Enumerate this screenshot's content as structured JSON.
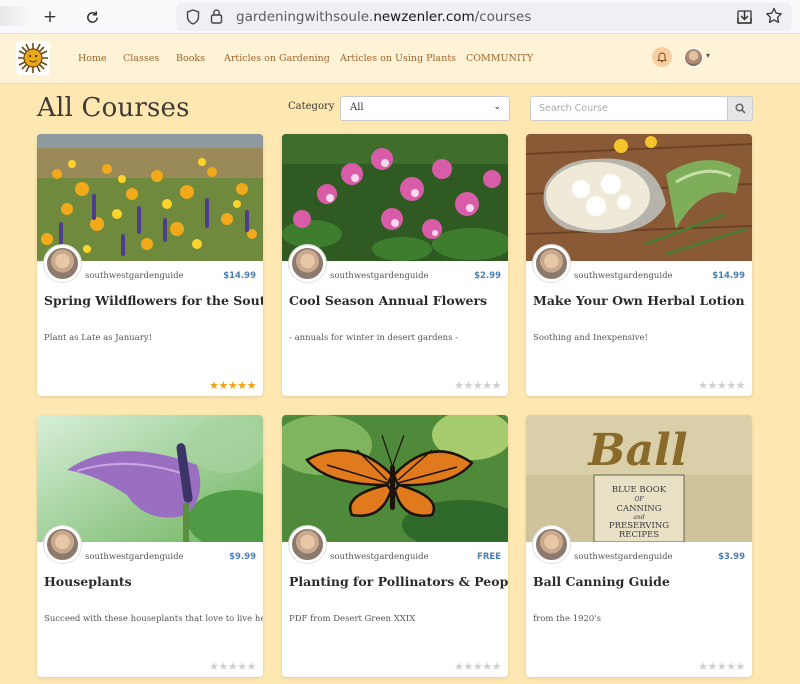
{
  "browser": {
    "url_prefix": "gardeningwithsoule.",
    "url_domain": "newzenler.com",
    "url_path": "/courses"
  },
  "nav": {
    "links": [
      "Home",
      "Classes",
      "Books",
      "Articles on Gardening",
      "Articles on Using Plants",
      "COMMUNITY"
    ]
  },
  "page": {
    "title": "All Courses",
    "category_label": "Category",
    "category_value": "All",
    "search_placeholder": "Search Course"
  },
  "courses": [
    {
      "author": "southwestgardenguide",
      "price": "$14.99",
      "title": "Spring Wildflowers for the Southwest",
      "subtitle": "Plant as Late as January!",
      "rating": 5,
      "image": "wildflowers"
    },
    {
      "author": "southwestgardenguide",
      "price": "$2.99",
      "title": "Cool Season Annual Flowers",
      "subtitle": "- annuals for winter in desert gardens -",
      "rating": 0,
      "image": "snapdragons"
    },
    {
      "author": "southwestgardenguide",
      "price": "$14.99",
      "title": "Make Your Own Herbal Lotion",
      "subtitle": "Soothing and Inexpensive!",
      "rating": 0,
      "image": "herbal-lotion"
    },
    {
      "author": "southwestgardenguide",
      "price": "$9.99",
      "title": "Houseplants",
      "subtitle": "Succeed with these houseplants that love to live here!",
      "rating": 0,
      "image": "anthurium"
    },
    {
      "author": "southwestgardenguide",
      "price": "FREE",
      "title": "Planting for Pollinators & People",
      "subtitle": "PDF from Desert Green XXIX",
      "rating": 0,
      "image": "monarch-butterfly"
    },
    {
      "author": "southwestgardenguide",
      "price": "$3.99",
      "title": "Ball Canning Guide",
      "subtitle": "from the 1920's",
      "rating": 0,
      "image": "ball-book-cover"
    }
  ],
  "ball_cover": {
    "brand": "Ball",
    "lines": [
      "BLUE BOOK",
      "OF",
      "CANNING",
      "and",
      "PRESERVING",
      "RECIPES"
    ]
  },
  "colors": {
    "page_bg": "#fde8b2",
    "nav_bg": "#fef3d6",
    "nav_link": "#a0652a",
    "price": "#4a7fb0",
    "star_on": "#f5a20c",
    "star_off": "#cfcfcf"
  }
}
